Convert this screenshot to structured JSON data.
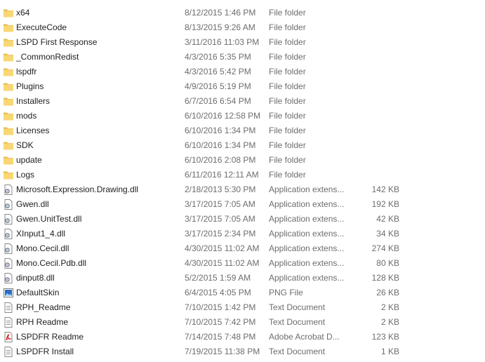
{
  "files": [
    {
      "name": "x64",
      "date": "8/12/2015 1:46 PM",
      "type": "File folder",
      "size": "",
      "icon": "folder-icon"
    },
    {
      "name": "ExecuteCode",
      "date": "8/13/2015 9:26 AM",
      "type": "File folder",
      "size": "",
      "icon": "folder-icon"
    },
    {
      "name": "LSPD First Response",
      "date": "3/11/2016 11:03 PM",
      "type": "File folder",
      "size": "",
      "icon": "folder-icon"
    },
    {
      "name": "_CommonRedist",
      "date": "4/3/2016 5:35 PM",
      "type": "File folder",
      "size": "",
      "icon": "folder-icon"
    },
    {
      "name": "lspdfr",
      "date": "4/3/2016 5:42 PM",
      "type": "File folder",
      "size": "",
      "icon": "folder-icon"
    },
    {
      "name": "Plugins",
      "date": "4/9/2016 5:19 PM",
      "type": "File folder",
      "size": "",
      "icon": "folder-icon"
    },
    {
      "name": "Installers",
      "date": "6/7/2016 6:54 PM",
      "type": "File folder",
      "size": "",
      "icon": "folder-icon"
    },
    {
      "name": "mods",
      "date": "6/10/2016 12:58 PM",
      "type": "File folder",
      "size": "",
      "icon": "folder-icon"
    },
    {
      "name": "Licenses",
      "date": "6/10/2016 1:34 PM",
      "type": "File folder",
      "size": "",
      "icon": "folder-icon"
    },
    {
      "name": "SDK",
      "date": "6/10/2016 1:34 PM",
      "type": "File folder",
      "size": "",
      "icon": "folder-icon"
    },
    {
      "name": "update",
      "date": "6/10/2016 2:08 PM",
      "type": "File folder",
      "size": "",
      "icon": "folder-icon"
    },
    {
      "name": "Logs",
      "date": "6/11/2016 12:11 AM",
      "type": "File folder",
      "size": "",
      "icon": "folder-icon"
    },
    {
      "name": "Microsoft.Expression.Drawing.dll",
      "date": "2/18/2013 5:30 PM",
      "type": "Application extens...",
      "size": "142 KB",
      "icon": "dll-icon"
    },
    {
      "name": "Gwen.dll",
      "date": "3/17/2015 7:05 AM",
      "type": "Application extens...",
      "size": "192 KB",
      "icon": "dll-icon"
    },
    {
      "name": "Gwen.UnitTest.dll",
      "date": "3/17/2015 7:05 AM",
      "type": "Application extens...",
      "size": "42 KB",
      "icon": "dll-icon"
    },
    {
      "name": "XInput1_4.dll",
      "date": "3/17/2015 2:34 PM",
      "type": "Application extens...",
      "size": "34 KB",
      "icon": "dll-icon"
    },
    {
      "name": "Mono.Cecil.dll",
      "date": "4/30/2015 11:02 AM",
      "type": "Application extens...",
      "size": "274 KB",
      "icon": "dll-icon"
    },
    {
      "name": "Mono.Cecil.Pdb.dll",
      "date": "4/30/2015 11:02 AM",
      "type": "Application extens...",
      "size": "80 KB",
      "icon": "dll-icon"
    },
    {
      "name": "dinput8.dll",
      "date": "5/2/2015 1:59 AM",
      "type": "Application extens...",
      "size": "128 KB",
      "icon": "dll-icon"
    },
    {
      "name": "DefaultSkin",
      "date": "6/4/2015 4:05 PM",
      "type": "PNG File",
      "size": "26 KB",
      "icon": "image-icon"
    },
    {
      "name": "RPH_Readme",
      "date": "7/10/2015 1:42 PM",
      "type": "Text Document",
      "size": "2 KB",
      "icon": "text-document-icon"
    },
    {
      "name": "RPH Readme",
      "date": "7/10/2015 7:42 PM",
      "type": "Text Document",
      "size": "2 KB",
      "icon": "text-document-icon"
    },
    {
      "name": "LSPDFR Readme",
      "date": "7/14/2015 7:48 PM",
      "type": "Adobe Acrobat D...",
      "size": "123 KB",
      "icon": "pdf-icon"
    },
    {
      "name": "LSPDFR Install",
      "date": "7/19/2015 11:38 PM",
      "type": "Text Document",
      "size": "1 KB",
      "icon": "text-document-icon"
    }
  ],
  "colors": {
    "folder": "#f8d775",
    "folder_shade": "#e7b845",
    "muted_text": "#6d6d6d",
    "primary_text": "#1e1e1e",
    "pdf_red": "#d4262a",
    "image_blue": "#2b6cc4"
  }
}
